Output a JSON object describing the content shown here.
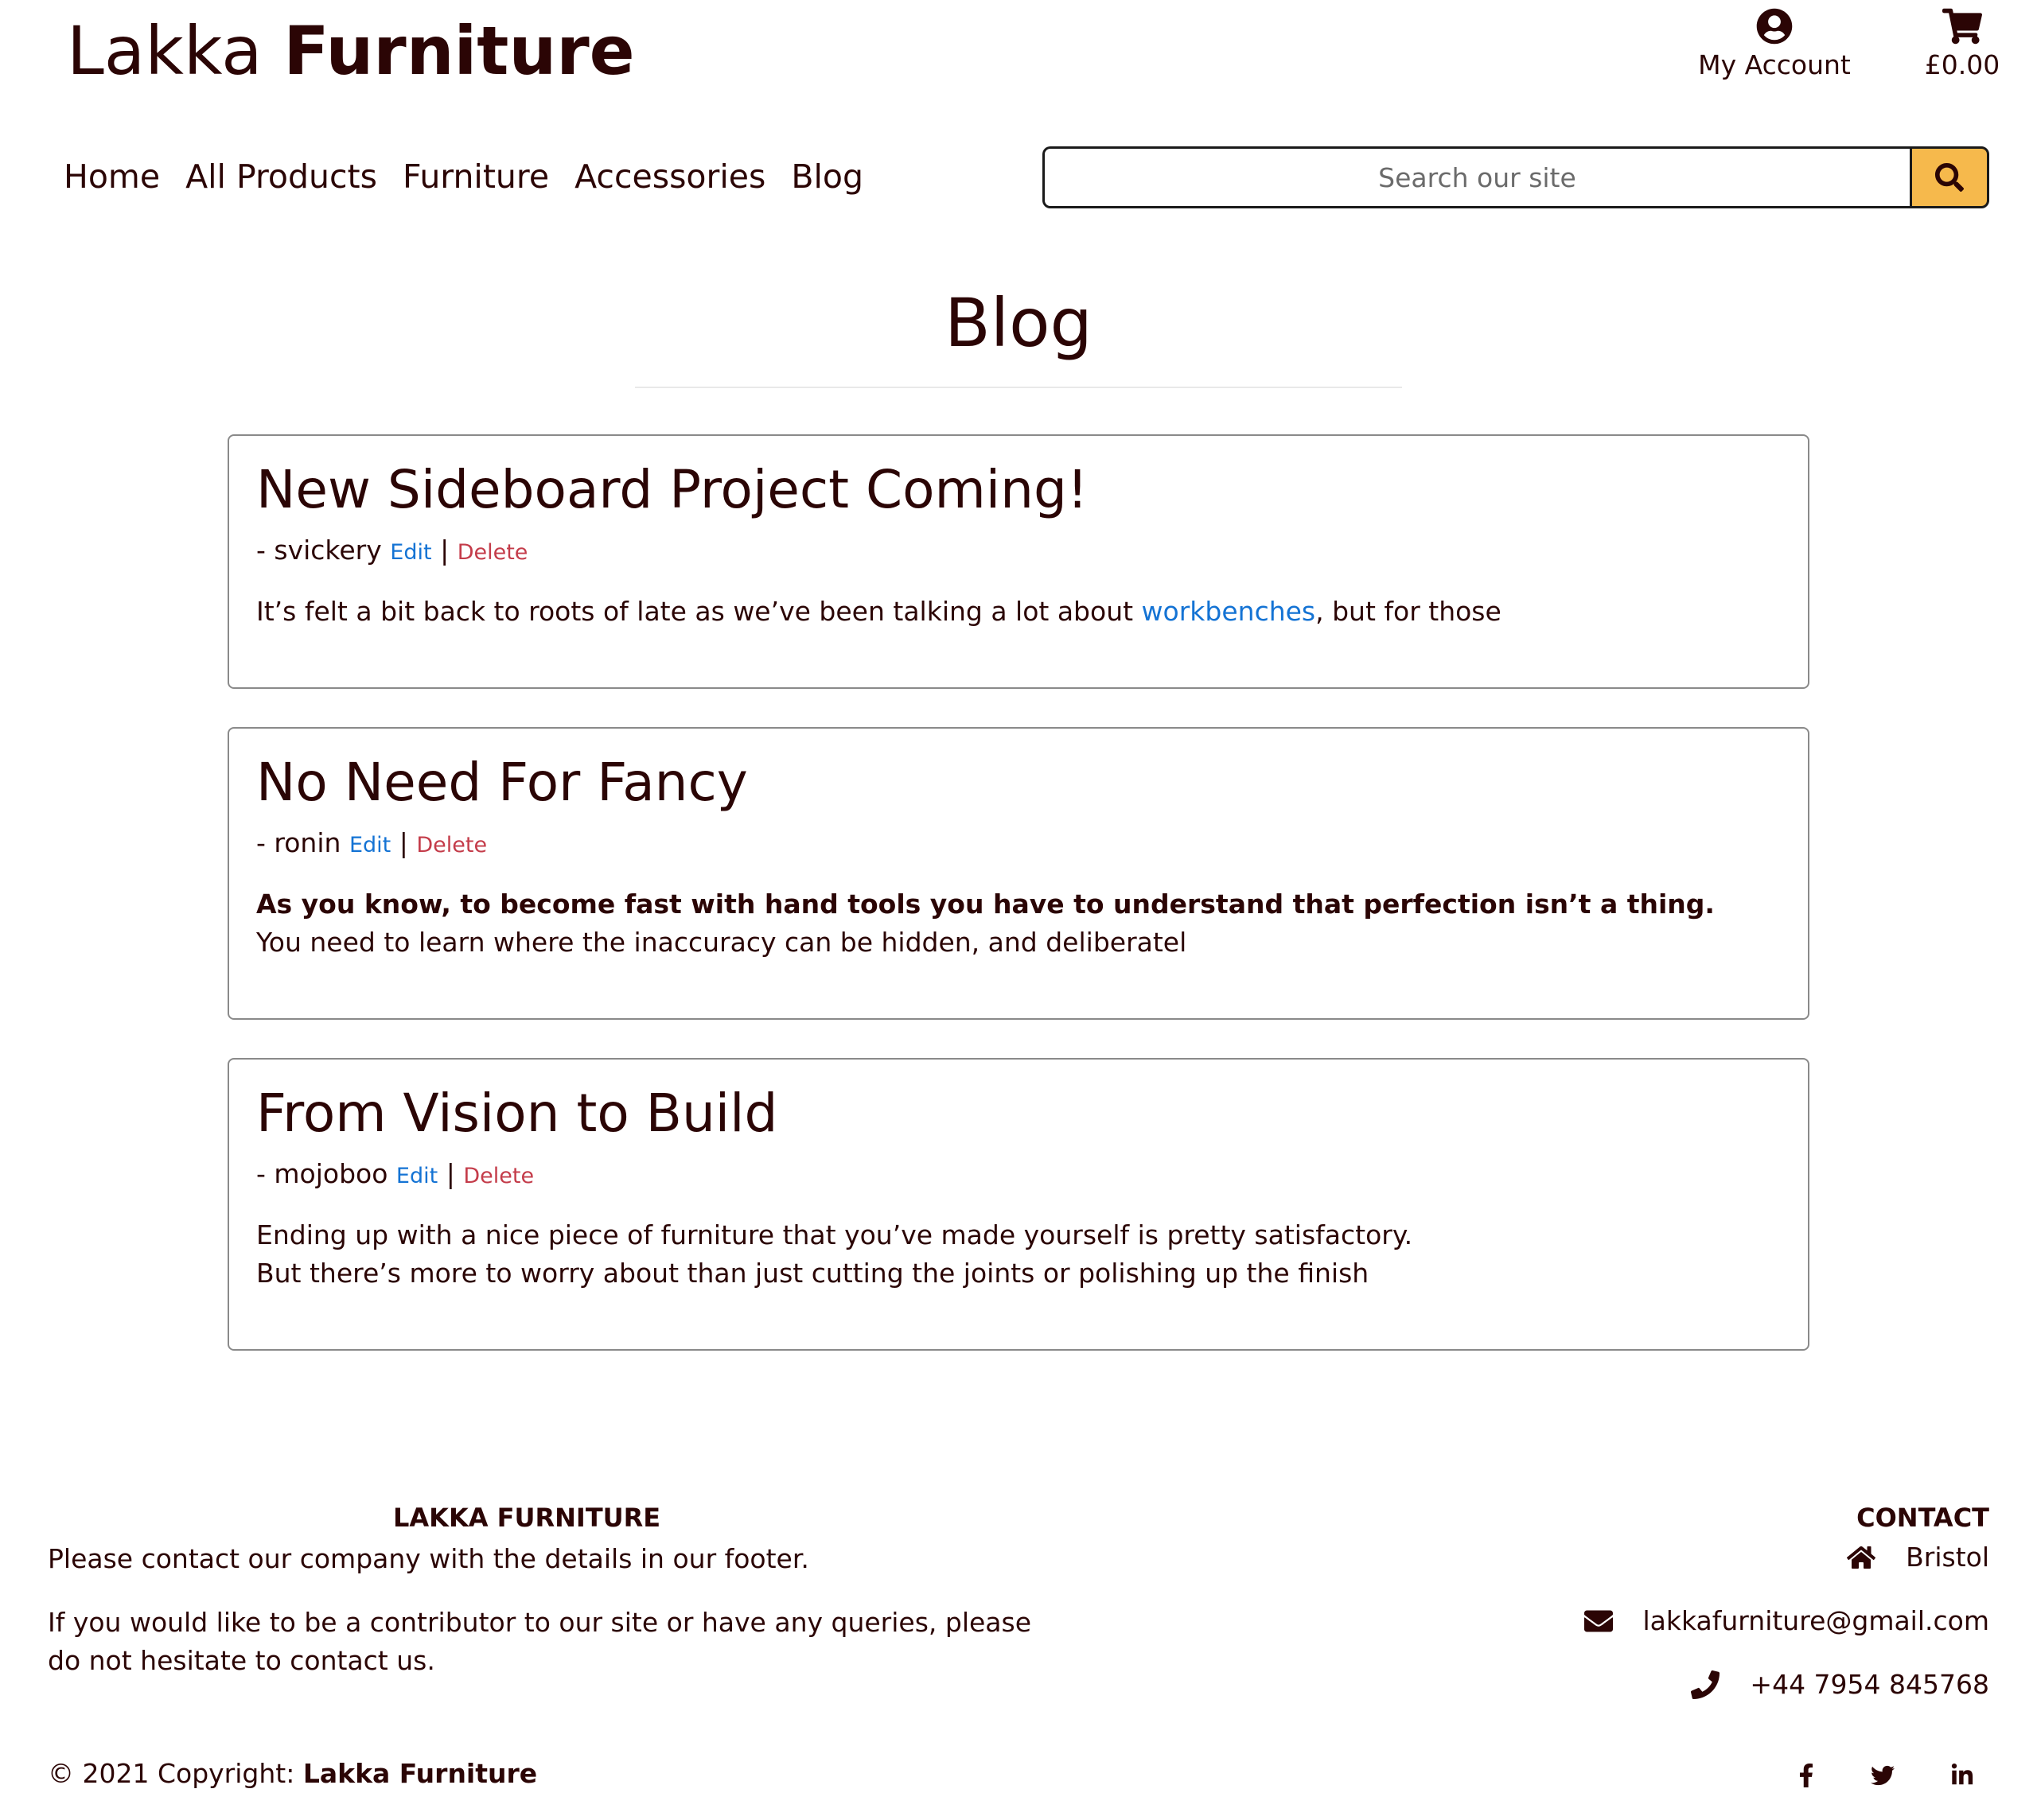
{
  "header": {
    "brand_light": "Lakka",
    "brand_bold": "Furniture",
    "account_label": "My Account",
    "cart_total": "£0.00",
    "icons": {
      "account": "user-circle-icon",
      "cart": "shopping-cart-icon",
      "search": "search-icon"
    }
  },
  "nav": {
    "items": [
      "Home",
      "All Products",
      "Furniture",
      "Accessories",
      "Blog"
    ]
  },
  "search": {
    "placeholder": "Search our site",
    "button_color": "#f6b94c"
  },
  "page": {
    "title": "Blog"
  },
  "posts": [
    {
      "title": "New Sideboard Project Coming!",
      "author": "- svickery",
      "edit_label": "Edit",
      "separator": "|",
      "delete_label": "Delete",
      "body_before": "It’s felt a bit back to roots of late as we’ve been talking a lot about ",
      "body_link": "workbenches",
      "body_after": ", but for those"
    },
    {
      "title": "No Need For Fancy",
      "author": "- ronin",
      "edit_label": "Edit",
      "separator": "|",
      "delete_label": "Delete",
      "body_bold": "As you know, to become fast with hand tools you have to understand that perfection isn’t a thing.",
      "body_line2": "You need to learn where the inaccuracy can be hidden, and deliberatel"
    },
    {
      "title": "From Vision to Build",
      "author": "- mojoboo",
      "edit_label": "Edit",
      "separator": "|",
      "delete_label": "Delete",
      "body_line1": "Ending up with a nice piece of furniture that you’ve made yourself is pretty satisfactory.",
      "body_line2": "But there’s more to worry about than just cutting the joints or polishing up the finish"
    }
  ],
  "footer": {
    "about_heading": "LAKKA FURNITURE",
    "about_text1": "Please contact our company with the details in our footer.",
    "about_text2_line1": "If you would like to be a contributor to our site or have any queries, please",
    "about_text2_line2": "do not hesitate to contact us.",
    "contact_heading": "CONTACT",
    "address": "Bristol",
    "email": "lakkafurniture@gmail.com",
    "phone": "+44 7954 845768",
    "copyright_prefix": "© 2021 Copyright: ",
    "copyright_name": "Lakka Furniture",
    "social_icons": [
      "facebook-icon",
      "twitter-icon",
      "linkedin-icon"
    ]
  },
  "colors": {
    "text": "#2b0505",
    "link": "#1473d4",
    "delete": "#c43c4a",
    "accent": "#f6b94c"
  }
}
